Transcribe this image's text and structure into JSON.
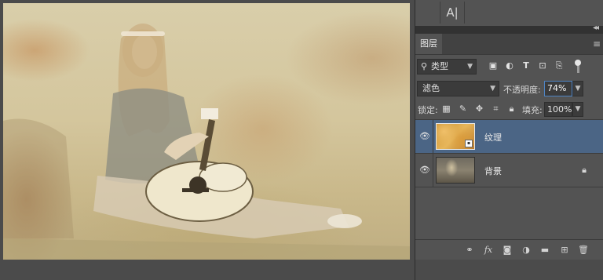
{
  "toolbar": {
    "character_tool_label": "A|"
  },
  "panel": {
    "collapse_label": "◂◂",
    "tab_label": "图层",
    "menu_icon": "menu-lines-icon"
  },
  "filter": {
    "kind_label": "类型",
    "icons": [
      "image-filter-icon",
      "adjustment-filter-icon",
      "type-filter-icon",
      "shape-filter-icon",
      "smartobject-filter-icon"
    ]
  },
  "blend": {
    "mode": "滤色",
    "opacity_label": "不透明度:",
    "opacity_value": "74%"
  },
  "lock": {
    "label": "锁定:",
    "fill_label": "填充:",
    "fill_value": "100%"
  },
  "layers": [
    {
      "name": "纹理",
      "visible": true,
      "selected": true,
      "locked": false
    },
    {
      "name": "背景",
      "visible": true,
      "selected": false,
      "locked": true
    }
  ],
  "footer_icons": [
    "link-layers-icon",
    "fx-icon",
    "add-mask-icon",
    "adjustment-layer-icon",
    "new-group-icon",
    "new-layer-icon",
    "delete-layer-icon"
  ],
  "colors": {
    "panel_bg": "#535353",
    "selected_layer": "#4b6585",
    "opacity_focus": "#4f84c4"
  }
}
